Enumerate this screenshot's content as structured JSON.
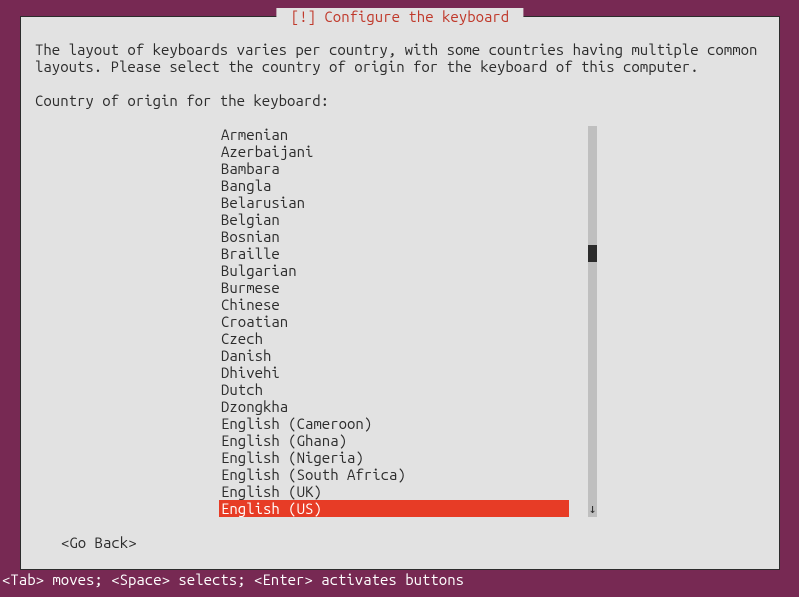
{
  "dialog": {
    "title": "[!] Configure the keyboard",
    "instruction": "The layout of keyboards varies per country, with some countries having multiple common layouts. Please select the country of origin for the keyboard of this computer.",
    "prompt": "Country of origin for the keyboard:",
    "go_back": "<Go Back>"
  },
  "list": {
    "items": [
      "Armenian",
      "Azerbaijani",
      "Bambara",
      "Bangla",
      "Belarusian",
      "Belgian",
      "Bosnian",
      "Braille",
      "Bulgarian",
      "Burmese",
      "Chinese",
      "Croatian",
      "Czech",
      "Danish",
      "Dhivehi",
      "Dutch",
      "Dzongkha",
      "English (Cameroon)",
      "English (Ghana)",
      "English (Nigeria)",
      "English (South Africa)",
      "English (UK)",
      "English (US)"
    ],
    "selected_index": 22
  },
  "footer": {
    "hint": "<Tab> moves; <Space> selects; <Enter> activates buttons"
  }
}
